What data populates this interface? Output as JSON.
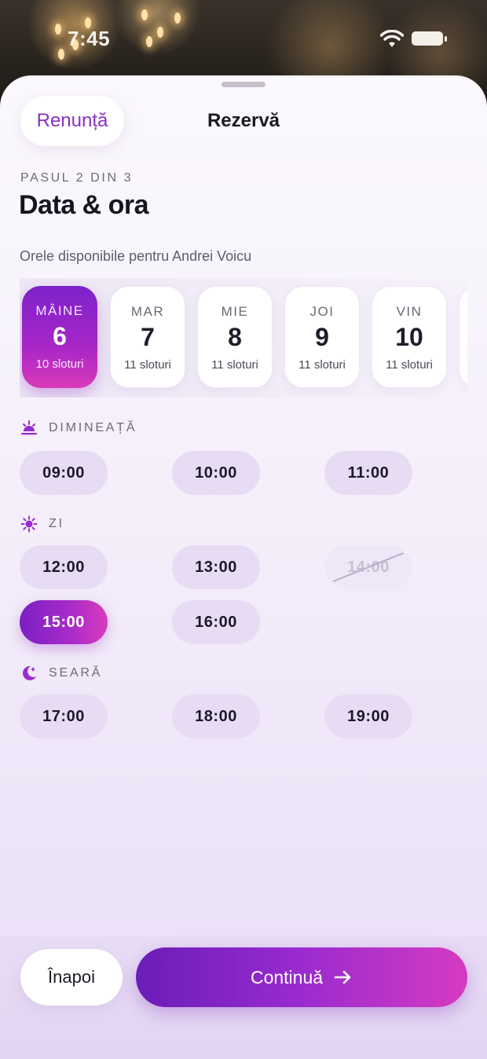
{
  "status_bar": {
    "time": "7:45"
  },
  "header": {
    "cancel_label": "Renunță",
    "title": "Rezervă"
  },
  "step": {
    "label": "PASUL 2 DIN 3",
    "heading": "Data & ora",
    "subtitle": "Orele disponibile pentru Andrei Voicu"
  },
  "days": [
    {
      "name": "MÂINE",
      "number": "6",
      "slots": "10 sloturi",
      "selected": true
    },
    {
      "name": "MAR",
      "number": "7",
      "slots": "11 sloturi",
      "selected": false
    },
    {
      "name": "MIE",
      "number": "8",
      "slots": "11 sloturi",
      "selected": false
    },
    {
      "name": "JOI",
      "number": "9",
      "slots": "11 sloturi",
      "selected": false
    },
    {
      "name": "VIN",
      "number": "10",
      "slots": "11 sloturi",
      "selected": false
    }
  ],
  "sections": {
    "morning": {
      "label": "DIMINEAȚĂ",
      "icon": "sunrise-icon",
      "slots": [
        "09:00",
        "10:00",
        "11:00"
      ]
    },
    "day": {
      "label": "ZI",
      "icon": "sun-icon",
      "slots": [
        "12:00",
        "13:00",
        "14:00",
        "15:00",
        "16:00"
      ],
      "unavailable": "14:00",
      "selected": "15:00"
    },
    "evening": {
      "label": "SEARĂ",
      "icon": "moon-icon",
      "slots": [
        "17:00",
        "18:00",
        "19:00"
      ]
    }
  },
  "footer": {
    "back_label": "Înapoi",
    "continue_label": "Continuă",
    "continue_icon": "arrow-right-icon"
  },
  "colors": {
    "accent": "#8a2fc5",
    "gradient_start": "#7b1fc2",
    "gradient_end": "#d93bbd",
    "slot_bg": "#e8dcf4"
  }
}
